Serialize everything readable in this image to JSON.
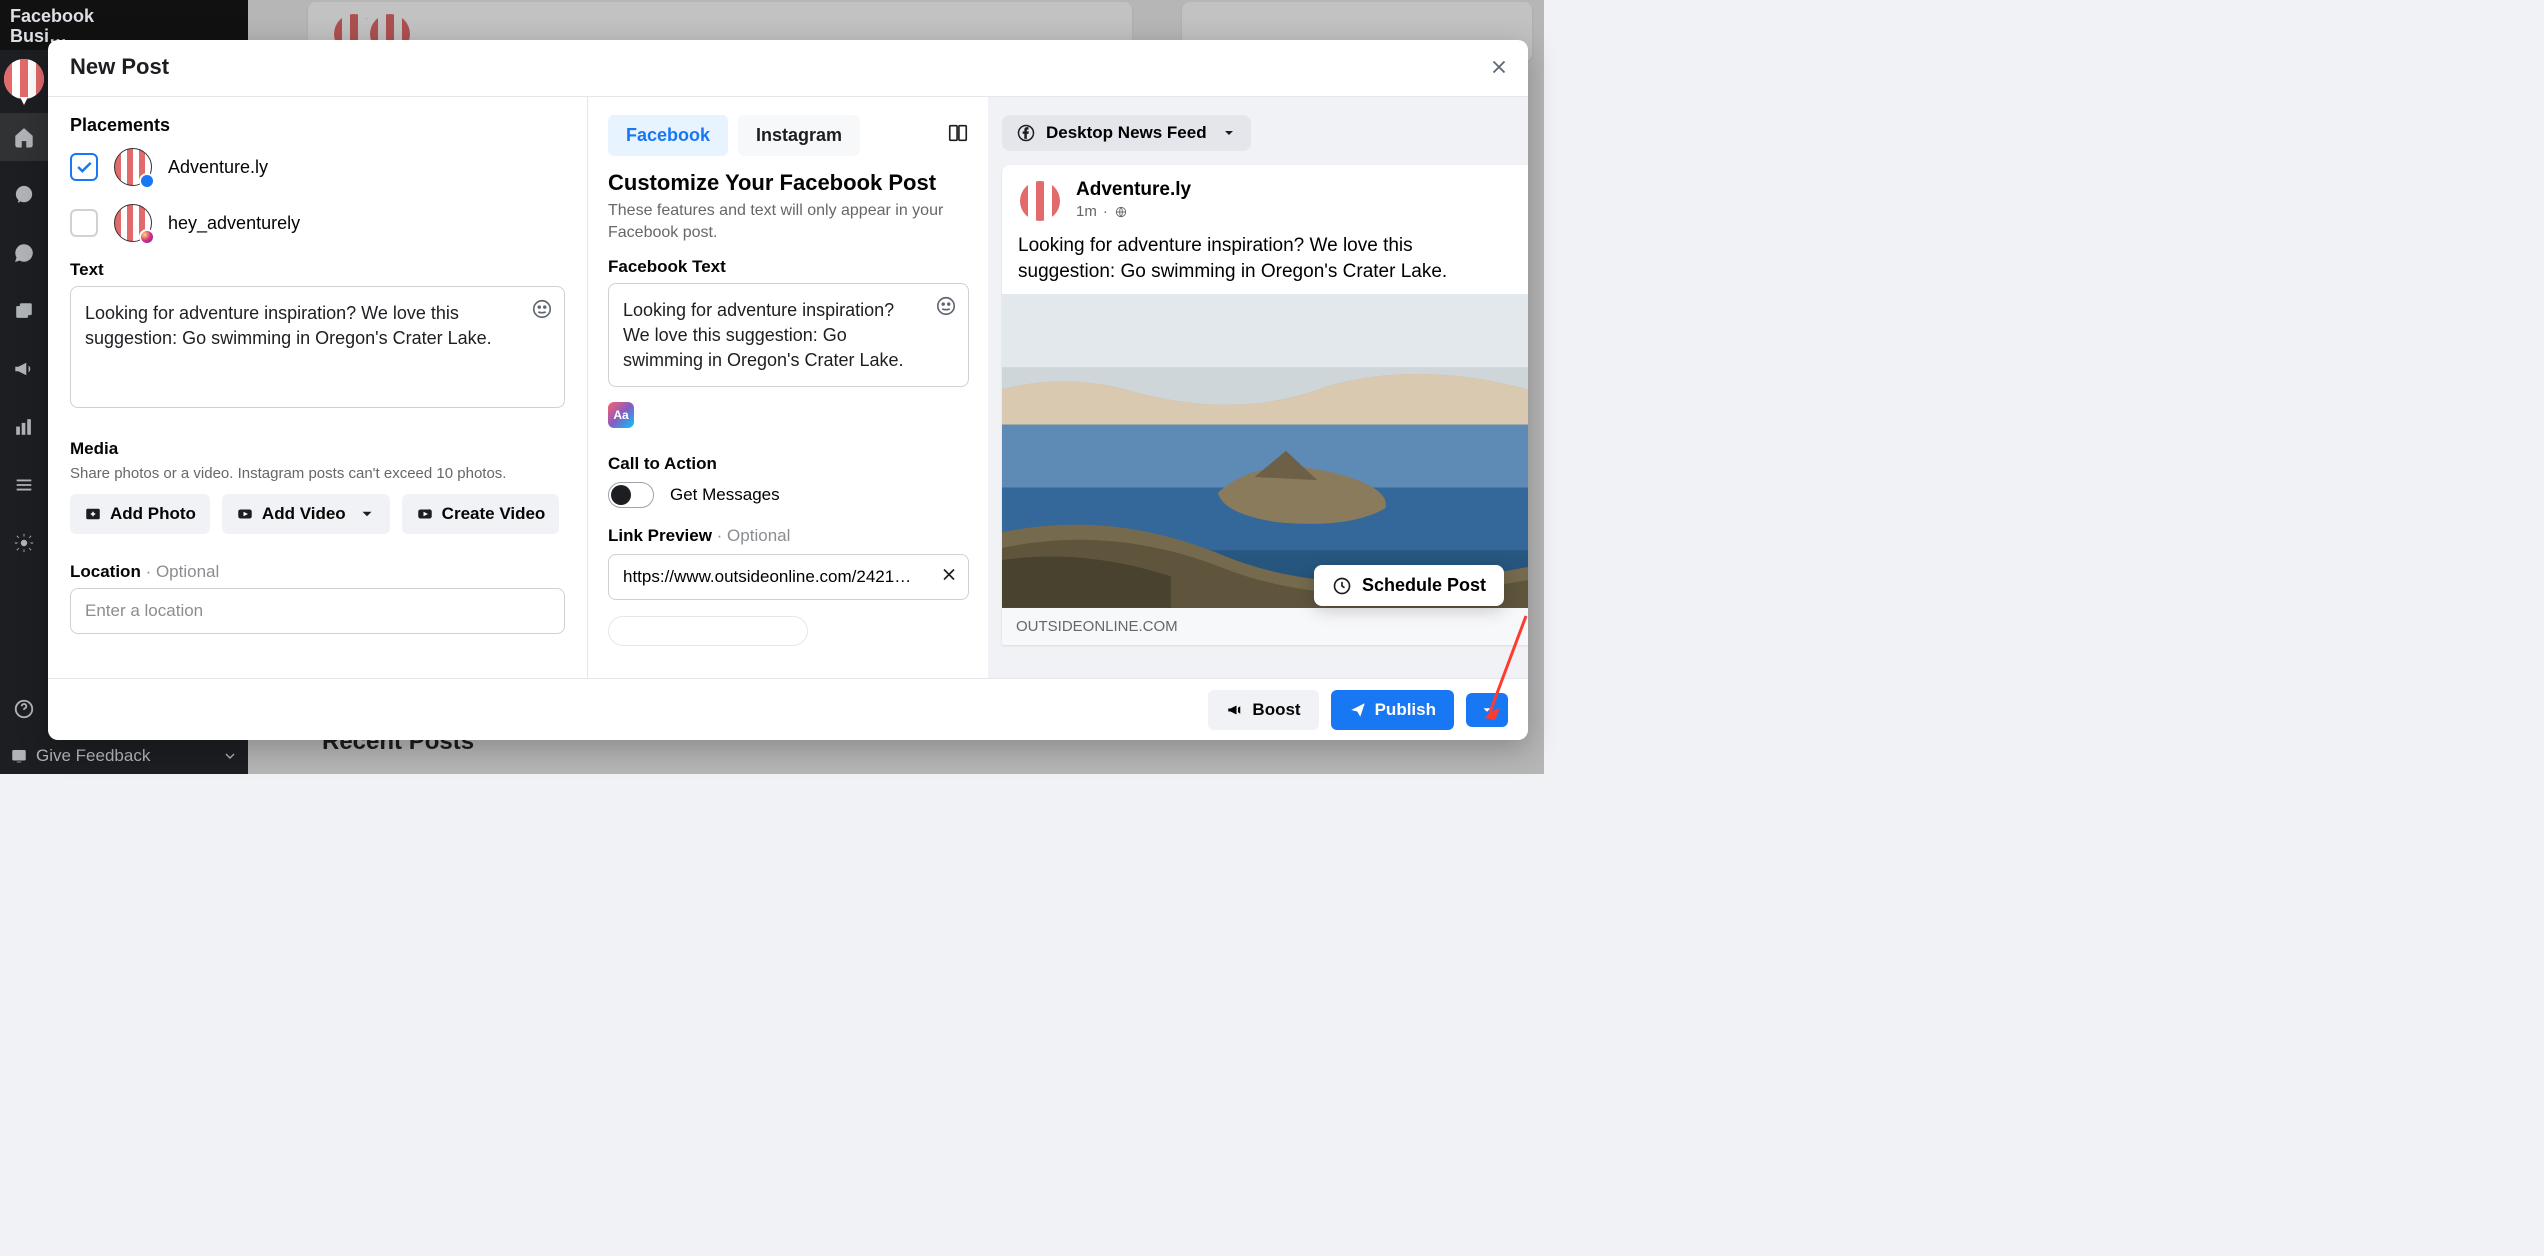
{
  "app": {
    "brand_line1": "Facebook",
    "brand_line2": "Busi…",
    "feedback_label": "Give Feedback"
  },
  "bg": {
    "recent": "Recent Posts"
  },
  "modal": {
    "title": "New Post",
    "placements_title": "Placements",
    "placements": [
      {
        "name": "Adventure.ly",
        "checked": true,
        "badge": "fb"
      },
      {
        "name": "hey_adventurely",
        "checked": false,
        "badge": "ig"
      }
    ],
    "text_label": "Text",
    "text_value": "Looking for adventure inspiration? We love this suggestion: Go swimming in Oregon's Crater Lake.",
    "media": {
      "title": "Media",
      "hint": "Share photos or a video. Instagram posts can't exceed 10 photos.",
      "add_photo": "Add Photo",
      "add_video": "Add Video",
      "create_video": "Create Video"
    },
    "location": {
      "title": "Location ",
      "optional": "· Optional",
      "placeholder": "Enter a location"
    }
  },
  "mid": {
    "tabs": {
      "facebook": "Facebook",
      "instagram": "Instagram"
    },
    "customize_title": "Customize Your Facebook Post",
    "customize_desc": "These features and text will only appear in your Facebook post.",
    "fb_text_label": "Facebook Text",
    "fb_text_value": "Looking for adventure inspiration? We love this suggestion: Go swimming in Oregon's Crater Lake.",
    "aa": "Aa",
    "cta_title": "Call to Action",
    "cta_label": "Get Messages",
    "link_title": "Link Preview ",
    "link_optional": "· Optional",
    "link_value": "https://www.outsideonline.com/2421…"
  },
  "right": {
    "feed_select": "Desktop News Feed",
    "page_name": "Adventure.ly",
    "timestamp": "1m",
    "post_text": "Looking for adventure inspiration? We love this suggestion: Go swimming in Oregon's Crater Lake.",
    "link_domain": "OUTSIDEONLINE.COM",
    "schedule": "Schedule Post"
  },
  "footer": {
    "boost": "Boost",
    "publish": "Publish"
  }
}
